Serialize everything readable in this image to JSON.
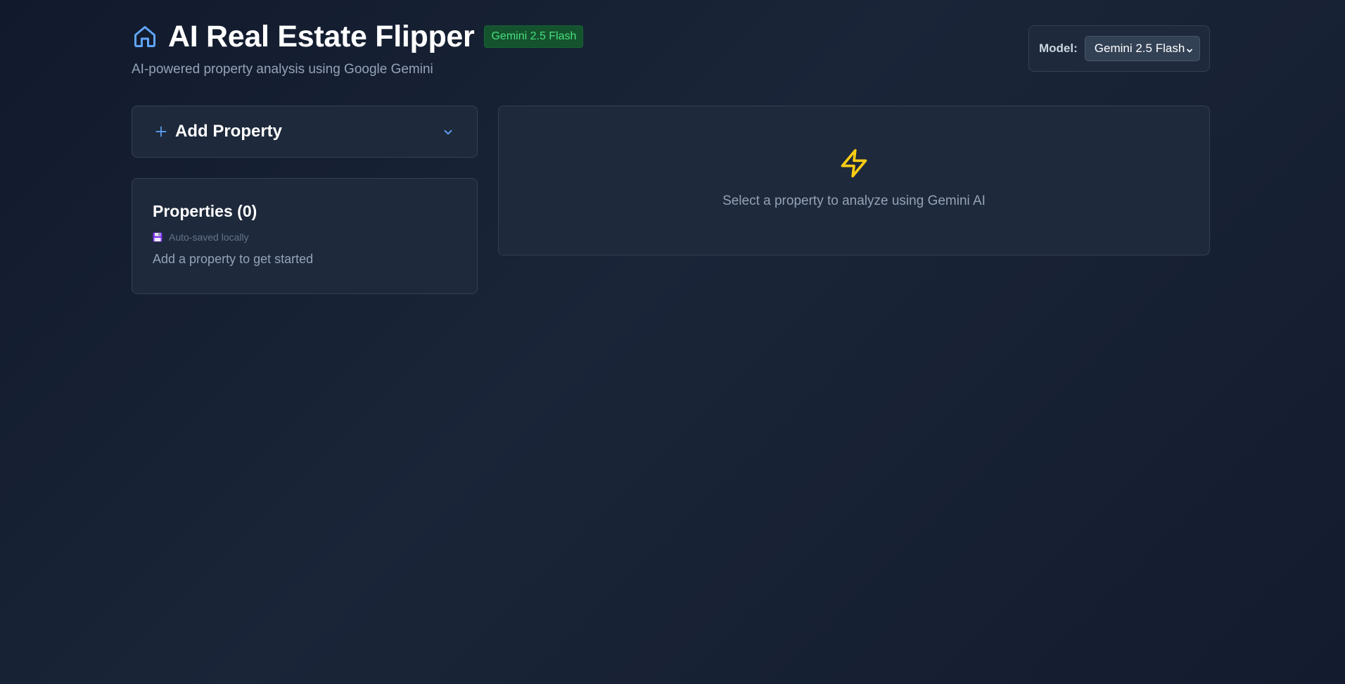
{
  "header": {
    "title": "AI Real Estate Flipper",
    "badge": "Gemini 2.5 Flash",
    "subtitle": "AI-powered property analysis using Google Gemini",
    "home_icon": "home-icon"
  },
  "model_picker": {
    "label": "Model:",
    "selected": "Gemini 2.5 Flash"
  },
  "add_property": {
    "title": "Add Property",
    "icon": "plus-icon",
    "toggle_icon": "chevron-down-icon"
  },
  "properties": {
    "title": "Properties (0)",
    "saved_status": "Auto-saved locally",
    "saved_icon": "floppy-disk-icon",
    "empty_message": "Add a property to get started"
  },
  "analysis": {
    "icon": "lightning-bolt-icon",
    "message": "Select a property to analyze using Gemini AI"
  },
  "colors": {
    "accent_blue": "#60a5fa",
    "badge_green": "#4ade80",
    "bolt_yellow": "#facc15",
    "card_bg": "#1e293b"
  }
}
